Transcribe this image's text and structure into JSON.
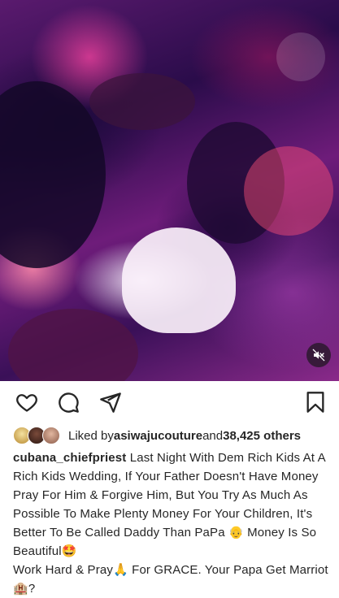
{
  "media": {
    "mute_icon": "speaker-muted-icon"
  },
  "actions": {
    "like_icon": "heart-icon",
    "comment_icon": "comment-bubble-icon",
    "share_icon": "paper-plane-icon",
    "save_icon": "bookmark-icon"
  },
  "likes": {
    "prefix": "Liked by ",
    "liked_by_user": "asiwajucouture",
    "connector": " and ",
    "others_count": "38,425 others"
  },
  "caption": {
    "username": "cubana_chiefpriest",
    "text_line1": "Last Night With Dem Rich Kids At A Rich Kids Wedding, If Your Father Doesn't Have Money Pray For Him & Forgive Him, But You Try As Much As Possible To Make Plenty Money For Your Children, It's Better To Be Called Daddy Than PaPa 👴 Money Is So Beautiful🤩",
    "text_line2": "Work Hard & Pray🙏 For GRACE. Your Papa Get Marriot🏨?"
  }
}
